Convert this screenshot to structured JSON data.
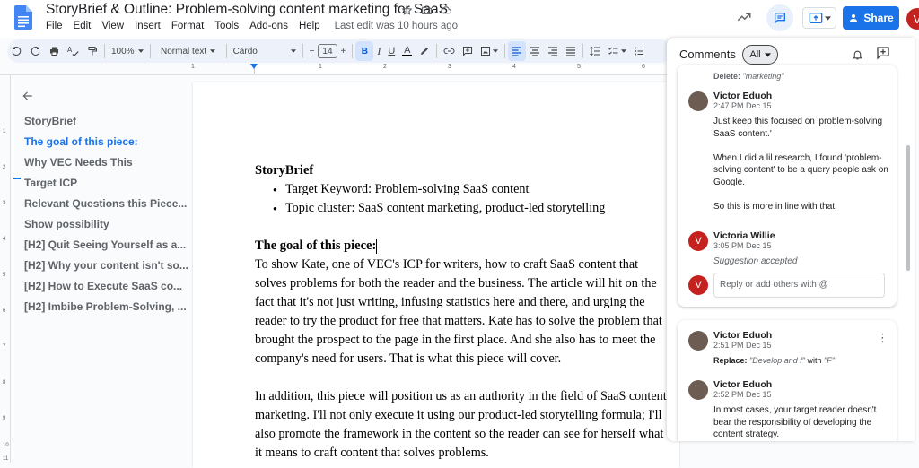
{
  "window": {
    "title": "StoryBrief & Outline: Problem-solving content marketing for SaaS",
    "menus": [
      "File",
      "Edit",
      "View",
      "Insert",
      "Format",
      "Tools",
      "Add-ons",
      "Help"
    ],
    "last_edit": "Last edit was 10 hours ago",
    "share_label": "Share",
    "user_initial": "V"
  },
  "toolbar": {
    "zoom": "100%",
    "style": "Normal text",
    "font": "Cardo",
    "font_size": "14",
    "bold": "B",
    "italic": "I",
    "underline": "U",
    "text_color": "A"
  },
  "ruler": {
    "ticks": [
      "1",
      "1",
      "2",
      "3",
      "4",
      "5",
      "6"
    ],
    "vticks": [
      "1",
      "2",
      "3",
      "4",
      "5",
      "6",
      "7",
      "8",
      "9",
      "10",
      "11"
    ]
  },
  "outline": {
    "items": [
      {
        "label": "StoryBrief",
        "active": false
      },
      {
        "label": "The goal of this piece:",
        "active": true
      },
      {
        "label": "Why VEC Needs This",
        "active": false
      },
      {
        "label": "Target ICP",
        "active": false
      },
      {
        "label": "Relevant Questions this Piece...",
        "active": false
      },
      {
        "label": "Show possibility",
        "active": false
      },
      {
        "label": "[H2] Quit Seeing Yourself as a...",
        "active": false
      },
      {
        "label": "[H2] Why your content isn't so...",
        "active": false
      },
      {
        "label": "[H2] How to Execute SaaS co...",
        "active": false
      },
      {
        "label": "[H2] Imbibe Problem-Solving, ...",
        "active": false
      }
    ]
  },
  "document": {
    "heading1": "StoryBrief",
    "bullets": [
      "Target Keyword: Problem-solving SaaS content",
      "Topic cluster: SaaS content marketing, product-led storytelling"
    ],
    "heading2": "The goal of this piece:",
    "para1": "To show Kate, one of VEC's ICP for writers, how to craft SaaS content that solves problems for both the reader and the business. The article will hit on the fact that it's not just writing, infusing statistics here and there, and urging the reader to try the product for free that matters. Kate has to solve the problem that brought the prospect to the page in the first place. And she also has to meet the company's need for users.  That is what this piece will cover.",
    "para2": "In addition, this piece will position us as an authority in the field of SaaS content marketing. I'll not only execute it using our product-led storytelling formula; I'll also promote the framework in the content so the reader can see for herself what it means to craft content that solves problems."
  },
  "comments": {
    "title": "Comments",
    "filter": "All",
    "delete_label": "Delete:",
    "delete_value": "\"marketing\"",
    "thread1": [
      {
        "name": "Victor Eduoh",
        "time": "2:47 PM Dec 15",
        "paragraphs": [
          "Just keep this focused on 'problem-solving SaaS content.'",
          "When I did a lil research, I found 'problem-solving content' to be a query people ask on Google.",
          "So this is more in line with that."
        ]
      },
      {
        "name": "Victoria Willie",
        "time": "3:05 PM Dec 15",
        "status": "Suggestion accepted",
        "initial": "V"
      }
    ],
    "reply_placeholder": "Reply or add others with @",
    "thread2": [
      {
        "name": "Victor Eduoh",
        "time": "2:51 PM Dec 15",
        "replace_label": "Replace:",
        "replace_from": "\"Develop and f\"",
        "replace_with_word": "with",
        "replace_to": "\"F\""
      },
      {
        "name": "Victor Eduoh",
        "time": "2:52 PM Dec 15",
        "text": "In most cases, your target reader doesn't bear the responsibility of developing the content strategy."
      }
    ]
  }
}
